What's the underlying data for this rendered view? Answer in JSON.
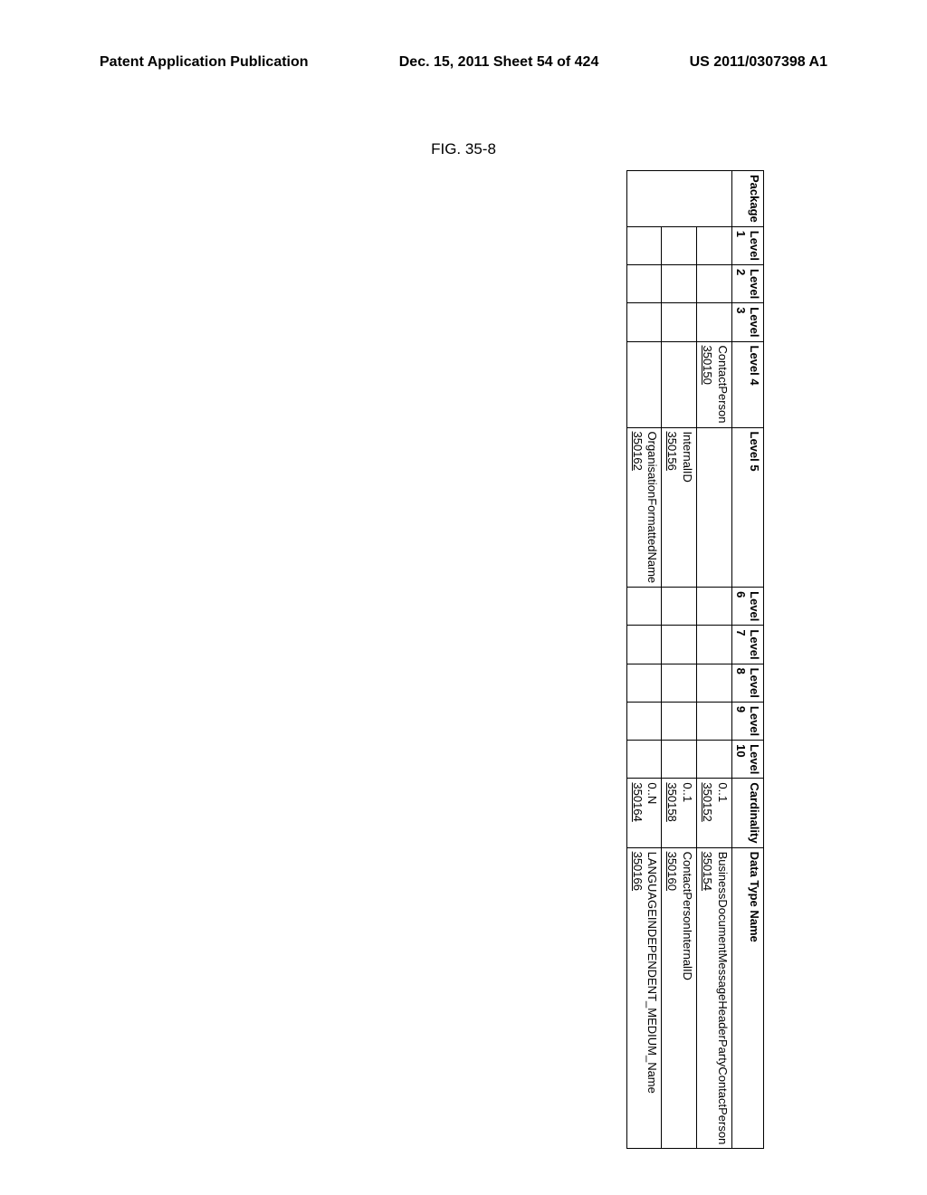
{
  "header": {
    "left": "Patent Application Publication",
    "center": "Dec. 15, 2011  Sheet 54 of 424",
    "right": "US 2011/0307398 A1"
  },
  "figure_label": "FIG. 35-8",
  "columns": {
    "package": "Package",
    "level1": "Level 1",
    "level2": "Level 2",
    "level3": "Level 3",
    "level4": "Level 4",
    "level5": "Level 5",
    "level6": "Level 6",
    "level7": "Level 7",
    "level8": "Level 8",
    "level9": "Level 9",
    "level10": "Level 10",
    "cardin": "Cardinality",
    "data": "Data Type Name"
  },
  "rows": [
    {
      "level4_text": "ContactPerson",
      "level4_ref": "350150",
      "cardin_text": "0..1",
      "cardin_ref": "350152",
      "data_text": "BusinessDocumentMessageHeaderPartyContactPerson",
      "data_ref": "350154"
    },
    {
      "level5_text": "InternalID",
      "level5_ref": "350156",
      "cardin_text": "0..1",
      "cardin_ref": "350158",
      "data_text": "ContactPersonInternalID",
      "data_ref": "350160"
    },
    {
      "level5_text": "OrganisationFormattedName",
      "level5_ref": "350162",
      "cardin_text": "0..N",
      "cardin_ref": "350164",
      "data_text": "LANGUAGEINDEPENDENT_MEDIUM_Name",
      "data_ref": "350166"
    }
  ]
}
